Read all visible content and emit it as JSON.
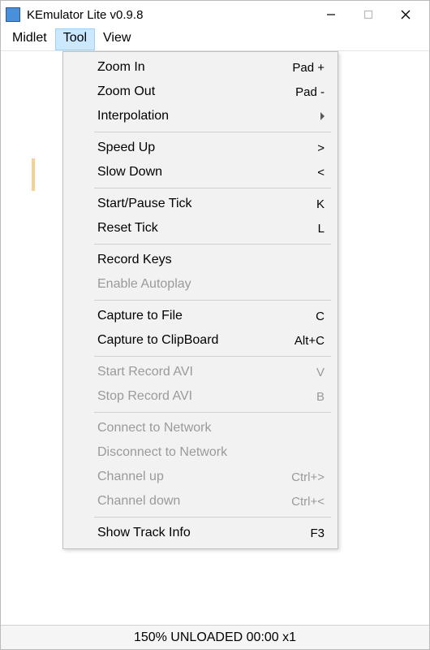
{
  "window": {
    "title": "KEmulator Lite v0.9.8"
  },
  "menubar": {
    "items": [
      {
        "label": "Midlet"
      },
      {
        "label": "Tool"
      },
      {
        "label": "View"
      }
    ],
    "active_index": 1
  },
  "dropdown": {
    "items": [
      {
        "label": "Zoom In",
        "shortcut": "Pad +",
        "enabled": true
      },
      {
        "label": "Zoom Out",
        "shortcut": "Pad -",
        "enabled": true
      },
      {
        "label": "Interpolation",
        "submenu": true,
        "enabled": true
      },
      {
        "sep": true
      },
      {
        "label": "Speed Up",
        "shortcut": ">",
        "enabled": true
      },
      {
        "label": "Slow Down",
        "shortcut": "<",
        "enabled": true
      },
      {
        "sep": true
      },
      {
        "label": "Start/Pause Tick",
        "shortcut": "K",
        "enabled": true
      },
      {
        "label": "Reset Tick",
        "shortcut": "L",
        "enabled": true
      },
      {
        "sep": true
      },
      {
        "label": "Record Keys",
        "enabled": true
      },
      {
        "label": "Enable Autoplay",
        "enabled": false
      },
      {
        "sep": true
      },
      {
        "label": "Capture to File",
        "shortcut": "C",
        "enabled": true
      },
      {
        "label": "Capture to ClipBoard",
        "shortcut": "Alt+C",
        "enabled": true
      },
      {
        "sep": true
      },
      {
        "label": "Start Record AVI",
        "shortcut": "V",
        "enabled": false
      },
      {
        "label": "Stop Record AVI",
        "shortcut": "B",
        "enabled": false
      },
      {
        "sep": true
      },
      {
        "label": "Connect to Network",
        "enabled": false
      },
      {
        "label": "Disconnect to Network",
        "enabled": false
      },
      {
        "label": "Channel up",
        "shortcut": "Ctrl+>",
        "enabled": false
      },
      {
        "label": "Channel down",
        "shortcut": "Ctrl+<",
        "enabled": false
      },
      {
        "sep": true
      },
      {
        "label": "Show Track Info",
        "shortcut": "F3",
        "enabled": true
      }
    ]
  },
  "statusbar": {
    "text": "150%  UNLOADED  00:00  x1"
  }
}
